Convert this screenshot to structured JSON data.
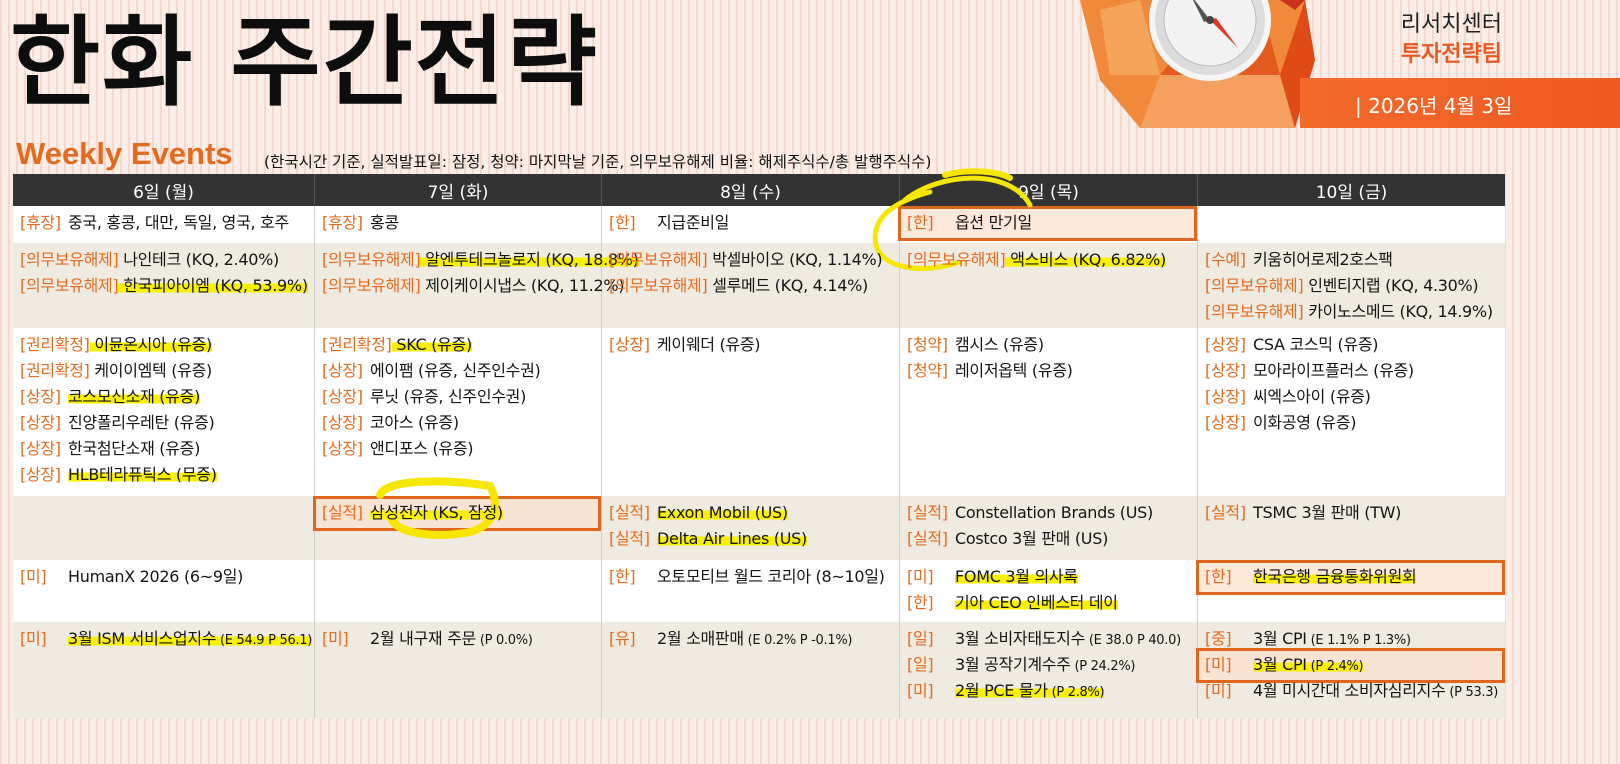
{
  "header": {
    "title": "한화 주간전략",
    "org_line1": "리서치센터",
    "org_line2": "투자전략팀",
    "date": "| 2026년 4월 3일"
  },
  "subtitle": "Weekly Events",
  "note": "(한국시간 기준, 실적발표일: 잠정, 청약: 마지막날 기준, 의무보유해제 비율: 해제주식수/총 발행주식수)",
  "colors": {
    "accent": "#e56c1f",
    "header_bg": "#333333",
    "highlight": "#f8f000",
    "box": "#e0651d"
  },
  "days": [
    "6일 (월)",
    "7일 (화)",
    "8일 (수)",
    "9일 (목)",
    "10일 (금)"
  ],
  "rows": [
    {
      "style": "white",
      "cells": [
        [
          {
            "tag": "[휴장]",
            "text": "중국, 홍콩, 대만, 독일, 영국, 호주"
          }
        ],
        [
          {
            "tag": "[휴장]",
            "text": "홍콩"
          }
        ],
        [
          {
            "tag": "[한]",
            "text": "지급준비일"
          }
        ],
        [
          {
            "tag": "[한]",
            "text": "옵션 만기일"
          }
        ],
        []
      ]
    },
    {
      "style": "beige",
      "cells": [
        [
          {
            "tag": "[의무보유해제]",
            "text": "나인테크 (KQ, 2.40%)"
          },
          {
            "tag": "[의무보유해제]",
            "text": "한국피아이엠 (KQ, 53.9%)"
          }
        ],
        [
          {
            "tag": "[의무보유해제]",
            "text": "알엔투테크놀로지 (KQ, 18.8%)"
          },
          {
            "tag": "[의무보유해제]",
            "text": "제이케이시냅스 (KQ, 11.2%)"
          }
        ],
        [
          {
            "tag": "[의무보유해제]",
            "text": "박셀바이오 (KQ, 1.14%)"
          },
          {
            "tag": "[의무보유해제]",
            "text": "셀루메드 (KQ, 4.14%)"
          }
        ],
        [
          {
            "tag": "[의무보유해제]",
            "text": "액스비스 (KQ, 6.82%)"
          }
        ],
        [
          {
            "tag": "[수예]",
            "text": "키움히어로제2호스팩"
          },
          {
            "tag": "[의무보유해제]",
            "text": "인벤티지랩 (KQ, 4.30%)"
          },
          {
            "tag": "[의무보유해제]",
            "text": "카이노스메드 (KQ, 14.9%)"
          }
        ]
      ]
    },
    {
      "style": "white",
      "cells": [
        [
          {
            "tag": "[권리확정]",
            "text": "이뮨온시아 (유증)"
          },
          {
            "tag": "[권리확정]",
            "text": "케이이엠텍 (유증)"
          },
          {
            "tag": "[상장]",
            "text": "코스모신소재 (유증)"
          },
          {
            "tag": "[상장]",
            "text": "진양폴리우레탄 (유증)"
          },
          {
            "tag": "[상장]",
            "text": "한국첨단소재 (유증)"
          },
          {
            "tag": "[상장]",
            "text": "HLB테라퓨틱스 (무증)"
          }
        ],
        [
          {
            "tag": "[권리확정]",
            "text": "SKC (유증)"
          },
          {
            "tag": "[상장]",
            "text": "에이팸 (유증, 신주인수권)"
          },
          {
            "tag": "[상장]",
            "text": "루닛 (유증, 신주인수권)"
          },
          {
            "tag": "[상장]",
            "text": "코아스 (유증)"
          },
          {
            "tag": "[상장]",
            "text": "앤디포스 (유증)"
          }
        ],
        [
          {
            "tag": "[상장]",
            "text": "케이웨더 (유증)"
          }
        ],
        [
          {
            "tag": "[청약]",
            "text": "캠시스 (유증)"
          },
          {
            "tag": "[청약]",
            "text": "레이저옵텍 (유증)"
          }
        ],
        [
          {
            "tag": "[상장]",
            "text": "CSA 코스믹 (유증)"
          },
          {
            "tag": "[상장]",
            "text": "모아라이프플러스 (유증)"
          },
          {
            "tag": "[상장]",
            "text": "씨엑스아이 (유증)"
          },
          {
            "tag": "[상장]",
            "text": "이화공영 (유증)"
          }
        ]
      ]
    },
    {
      "style": "beige",
      "cells": [
        [],
        [
          {
            "tag": "[실적]",
            "text": "삼성전자 (KS, 잠정)"
          }
        ],
        [
          {
            "tag": "[실적]",
            "text": "Exxon Mobil (US)"
          },
          {
            "tag": "[실적]",
            "text": "Delta Air Lines (US)"
          }
        ],
        [
          {
            "tag": "[실적]",
            "text": "Constellation Brands (US)"
          },
          {
            "tag": "[실적]",
            "text": "Costco 3월 판매 (US)"
          }
        ],
        [
          {
            "tag": "[실적]",
            "text": "TSMC 3월 판매 (TW)"
          }
        ]
      ]
    },
    {
      "style": "white",
      "cells": [
        [
          {
            "tag": "[미]",
            "text": "HumanX 2026 (6~9일)"
          }
        ],
        [],
        [
          {
            "tag": "[한]",
            "text": "오토모티브 월드 코리아 (8~10일)"
          }
        ],
        [
          {
            "tag": "[미]",
            "text": "FOMC 3월 의사록"
          },
          {
            "tag": "[한]",
            "text": "기아 CEO 인베스터 데이"
          }
        ],
        [
          {
            "tag": "[한]",
            "text": "한국은행 금융통화위원회"
          }
        ]
      ]
    },
    {
      "style": "beige",
      "cells": [
        [
          {
            "tag": "[미]",
            "text": "3월 ISM 서비스업지수",
            "small": "(E 54.9 P 56.1)"
          }
        ],
        [
          {
            "tag": "[미]",
            "text": "2월 내구재 주문",
            "small": "(P 0.0%)"
          }
        ],
        [
          {
            "tag": "[유]",
            "text": "2월 소매판매",
            "small": "(E 0.2% P -0.1%)"
          }
        ],
        [
          {
            "tag": "[일]",
            "text": "3월 소비자태도지수",
            "small": "(E 38.0 P 40.0)"
          },
          {
            "tag": "[일]",
            "text": "3월 공작기계수주",
            "small": "(P 24.2%)"
          },
          {
            "tag": "[미]",
            "text": "2월 PCE 물가",
            "small": "(P 2.8%)"
          }
        ],
        [
          {
            "tag": "[중]",
            "text": "3월 CPI",
            "small": "(E 1.1% P 1.3%)"
          },
          {
            "tag": "[미]",
            "text": "3월 CPI",
            "small": "(P 2.4%)"
          },
          {
            "tag": "[미]",
            "text": "4월 미시간대 소비자심리지수",
            "small": "(P 53.3)"
          }
        ]
      ]
    }
  ]
}
